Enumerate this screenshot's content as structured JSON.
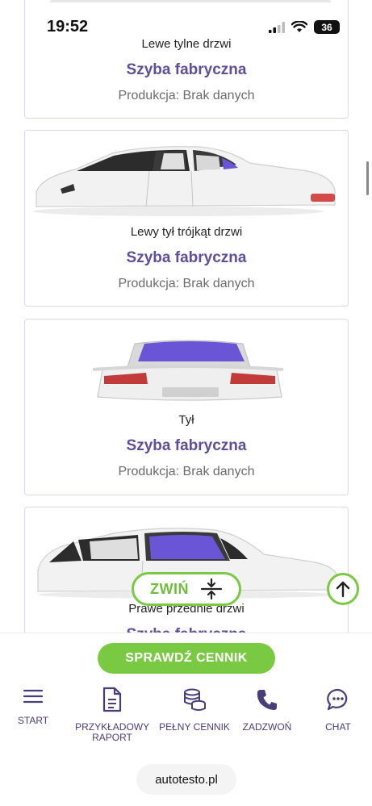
{
  "status": {
    "time": "19:52",
    "battery": "36"
  },
  "cards": [
    {
      "location": "Lewe tylne drzwi",
      "glass": "Szyba fabryczna",
      "production": "Produkcja: Brak danych"
    },
    {
      "location": "Lewy tył trójkąt drzwi",
      "glass": "Szyba fabryczna",
      "production": "Produkcja: Brak danych"
    },
    {
      "location": "Tył",
      "glass": "Szyba fabryczna",
      "production": "Produkcja: Brak danych"
    },
    {
      "location": "Prawe przednie drzwi",
      "glass": "Szyba fabryczna"
    }
  ],
  "collapse": {
    "label": "ZWIŃ"
  },
  "cta": {
    "label": "SPRAWDŹ CENNIK"
  },
  "nav": {
    "start": "START",
    "sample_report": "PRZYKŁADOWY RAPORT",
    "full_price": "PEŁNY CENNIK",
    "call": "ZADZWOŃ",
    "chat": "CHAT"
  },
  "url": "autotesto.pl",
  "colors": {
    "accent_green": "#7ac943",
    "brand_purple": "#5e4f98",
    "highlight_glass": "#6a55d6"
  },
  "icons": [
    "wifi-icon",
    "signal-icon",
    "arrow-up-icon",
    "collapse-icon",
    "menu-icon",
    "document-icon",
    "coins-icon",
    "phone-icon",
    "chat-icon"
  ]
}
